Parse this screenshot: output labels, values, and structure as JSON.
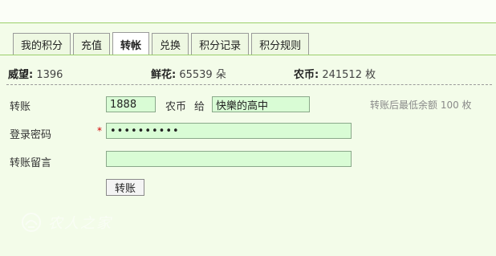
{
  "tabs": [
    {
      "label": "我的积分",
      "active": false
    },
    {
      "label": "充值",
      "active": false
    },
    {
      "label": "转帐",
      "active": true
    },
    {
      "label": "兑换",
      "active": false
    },
    {
      "label": "积分记录",
      "active": false
    },
    {
      "label": "积分规则",
      "active": false
    }
  ],
  "stats": {
    "prestige": {
      "label": "威望:",
      "value": "1396"
    },
    "flowers": {
      "label": "鲜花:",
      "value": "65539 朵"
    },
    "coins": {
      "label": "农币:",
      "value": "241512 枚"
    }
  },
  "form": {
    "transfer_label": "转账",
    "amount_value": "1888",
    "unit_text": "农币",
    "to_text": "给",
    "recipient_value": "快樂的高中",
    "hint": "转账后最低余额 100 枚",
    "password_label": "登录密码",
    "required_mark": "*",
    "password_value": "••••••••••",
    "message_label": "转账留言",
    "message_value": "",
    "submit_label": "转账"
  },
  "watermark": {
    "text": "农人之家"
  },
  "colors": {
    "background": "#f3fce9",
    "accent_line": "#9bcf6b",
    "input_bg": "#d9fcd5"
  }
}
